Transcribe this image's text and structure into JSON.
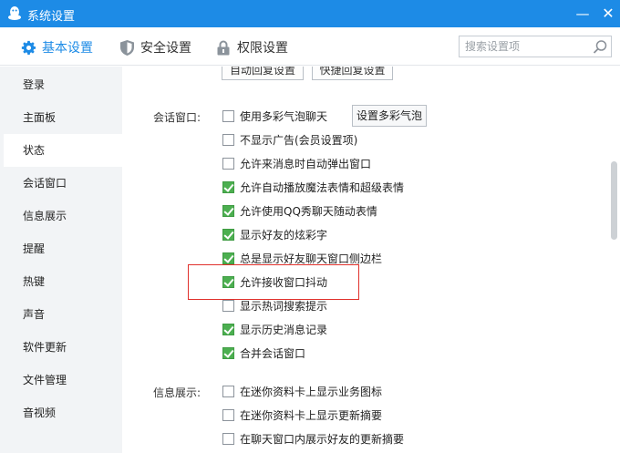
{
  "window": {
    "title": "系统设置",
    "minimize_label": "—",
    "close_label": "✕",
    "accent_color": "#1d8be6"
  },
  "tabs": [
    {
      "label": "基本设置",
      "icon": "gear-icon",
      "active": true
    },
    {
      "label": "安全设置",
      "icon": "shield-icon",
      "active": false
    },
    {
      "label": "权限设置",
      "icon": "lock-icon",
      "active": false
    }
  ],
  "search": {
    "placeholder": "搜索设置项",
    "value": ""
  },
  "sidebar": {
    "items": [
      {
        "label": "登录"
      },
      {
        "label": "主面板"
      },
      {
        "label": "状态",
        "active": true
      },
      {
        "label": "会话窗口"
      },
      {
        "label": "信息展示"
      },
      {
        "label": "提醒"
      },
      {
        "label": "热键"
      },
      {
        "label": "声音"
      },
      {
        "label": "软件更新"
      },
      {
        "label": "文件管理"
      },
      {
        "label": "音视频"
      }
    ]
  },
  "top_buttons": [
    "自动回复设置",
    "快捷回复设置"
  ],
  "session_window": {
    "label": "会话窗口:",
    "bubble_button": "设置多彩气泡",
    "options": [
      {
        "label": "使用多彩气泡聊天",
        "checked": false
      },
      {
        "label": "不显示广告(会员设置项)",
        "checked": false
      },
      {
        "label": "允许来消息时自动弹出窗口",
        "checked": false
      },
      {
        "label": "允许自动播放魔法表情和超级表情",
        "checked": true
      },
      {
        "label": "允许使用QQ秀聊天随动表情",
        "checked": true
      },
      {
        "label": "显示好友的炫彩字",
        "checked": true
      },
      {
        "label": "总是显示好友聊天窗口侧边栏",
        "checked": true
      },
      {
        "label": "允许接收窗口抖动",
        "checked": true,
        "highlighted": true
      },
      {
        "label": "显示热词搜索提示",
        "checked": false
      },
      {
        "label": "显示历史消息记录",
        "checked": true
      },
      {
        "label": "合并会话窗口",
        "checked": true
      }
    ]
  },
  "info_display": {
    "label": "信息展示:",
    "options": [
      {
        "label": "在迷你资料卡上显示业务图标",
        "checked": false
      },
      {
        "label": "在迷你资料卡上显示更新摘要",
        "checked": false
      },
      {
        "label": "在聊天窗口内展示好友的更新摘要",
        "checked": false
      }
    ]
  }
}
